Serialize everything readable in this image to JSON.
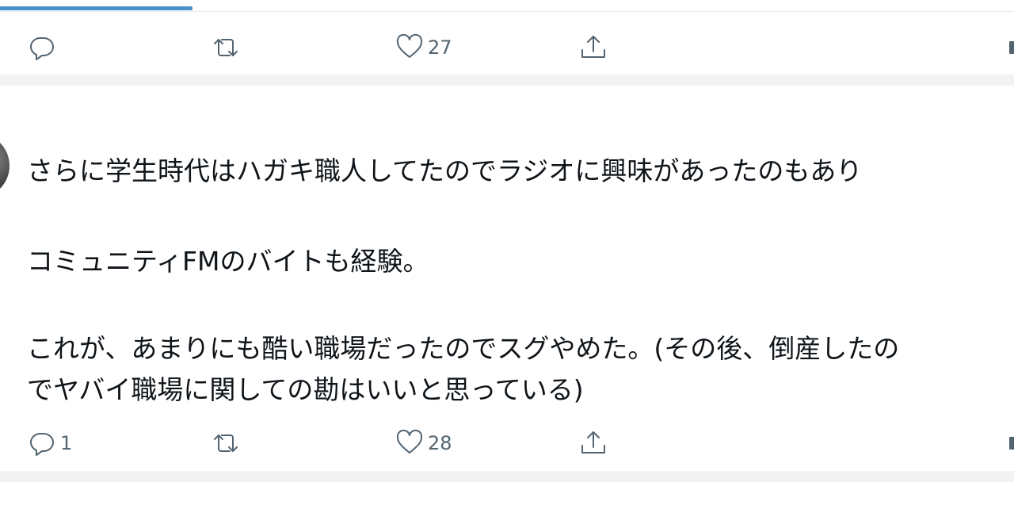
{
  "progress": {
    "fill_fraction": 0.19,
    "color": "#4a90c8"
  },
  "tweet1": {
    "actions": {
      "reply_count": "",
      "retweet_count": "",
      "like_count": "27"
    }
  },
  "tweet2": {
    "lines": [
      "さらに学生時代はハガキ職人してたのでラジオに興味があったのもあり",
      "コミュニティFMのバイトも経験。",
      "これが、あまりにも酷い職場だったのでスグやめた。(その後、倒産したの",
      "でヤバイ職場に関しての勘はいいと思っている)"
    ],
    "actions": {
      "reply_count": "1",
      "retweet_count": "",
      "like_count": "28"
    }
  },
  "icons": {
    "reply": "reply-icon",
    "retweet": "retweet-icon",
    "like": "heart-icon",
    "share": "share-icon"
  },
  "colors": {
    "icon_gray": "#536471",
    "text": "#0f1419",
    "divider": "#e6ecf0"
  }
}
